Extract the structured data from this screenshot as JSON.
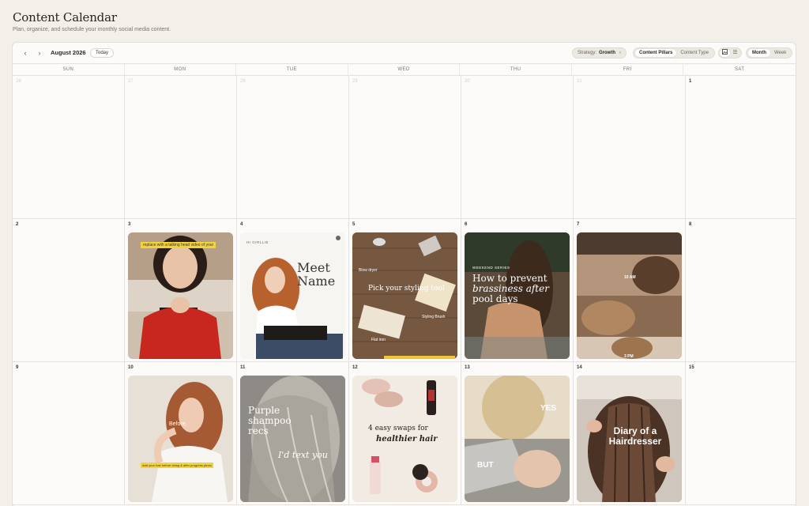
{
  "header": {
    "title": "Content Calendar",
    "subtitle": "Plan, organize, and schedule your monthly social media content."
  },
  "toolbar": {
    "prev_label": "‹",
    "next_label": "›",
    "month": "August 2026",
    "today_label": "Today",
    "strategy_label": "Strategy:",
    "strategy_value": "Growth",
    "strategy_chevron": "›",
    "filter_options": [
      "Content Pillars",
      "Content Type"
    ],
    "filter_selected": "Content Pillars",
    "view_icons": [
      "image-grid-icon",
      "list-icon"
    ],
    "view_modes": [
      "Month",
      "Week"
    ],
    "view_selected": "Month"
  },
  "weekdays": [
    "SUN",
    "MON",
    "TUE",
    "WED",
    "THU",
    "FRI",
    "SAT"
  ],
  "weeks": [
    [
      "26",
      "27",
      "28",
      "29",
      "30",
      "31",
      "1"
    ],
    [
      "2",
      "3",
      "4",
      "5",
      "6",
      "7",
      "8"
    ],
    [
      "9",
      "10",
      "11",
      "12",
      "13",
      "14",
      "15"
    ]
  ],
  "posts": {
    "aug3": {
      "caption": "replace with a talking head video of your"
    },
    "aug4": {
      "brand": "HI GIRLLIE",
      "title_line1": "Meet",
      "title_line2": "Name"
    },
    "aug5": {
      "title": "Pick your styling tool",
      "label_dryer": "Blow dryer",
      "label_brush": "Styling Brush",
      "label_iron": "Flat iron"
    },
    "aug6": {
      "tag": "WEEKEND SERIES",
      "line1": "How to prevent",
      "line2": "brassiness after",
      "line3": "pool days"
    },
    "aug7": {
      "time1": "10 AM",
      "time2": "3 PM"
    },
    "aug10": {
      "word": "Before,",
      "caption": "Add your hair before doing & after progress photo"
    },
    "aug11": {
      "line1": "Purple",
      "line2": "shampoo",
      "line3": "recs",
      "line4": "I'd text you"
    },
    "aug12": {
      "line1": "4 easy swaps for",
      "line2": "healthier hair"
    },
    "aug13": {
      "top": "YES",
      "bottom": "BUT"
    },
    "aug14": {
      "line1": "Diary of a",
      "line2": "Hairdresser"
    }
  }
}
